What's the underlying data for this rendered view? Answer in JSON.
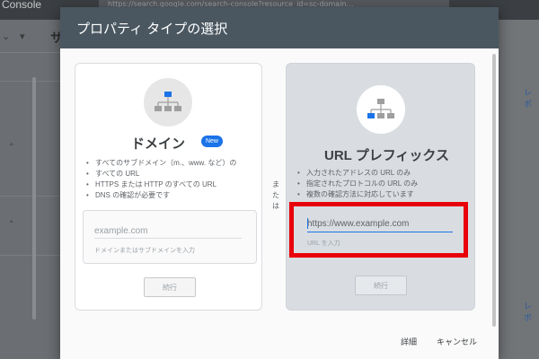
{
  "background": {
    "brand": "Console",
    "address_bar": "https://search.google.com/search-console?resource_id=sc-domain…",
    "sidebar_heading": "サ",
    "right_links": [
      "レポ",
      "レポ"
    ]
  },
  "dialog": {
    "title": "プロパティ タイプの選択",
    "or_label": "または",
    "footer": {
      "details": "詳細",
      "cancel": "キャンセル"
    },
    "header_color": "#4a5761"
  },
  "domain_card": {
    "icon": "sitemap-icon",
    "title": "ドメイン",
    "badge": "New",
    "bullets": [
      "すべてのサブドメイン（m.、www. など）の",
      "すべての URL",
      "HTTPS または HTTP のすべての URL",
      "DNS の確認が必要です"
    ],
    "input_placeholder": "example.com",
    "input_helper": "ドメインまたはサブドメインを入力",
    "continue_label": "続行"
  },
  "url_prefix_card": {
    "icon": "sitemap-icon",
    "title": "URL プレフィックス",
    "bullets": [
      "入力されたアドレスの URL のみ",
      "指定されたプロトコルの URL のみ",
      "複数の確認方法に対応しています"
    ],
    "input_placeholder": "https://www.example.com",
    "input_helper": "URL を入力",
    "continue_label": "続行",
    "highlight_color": "#e8000b"
  },
  "colors": {
    "accent": "#1a73e8",
    "highlight": "#e8000b"
  }
}
